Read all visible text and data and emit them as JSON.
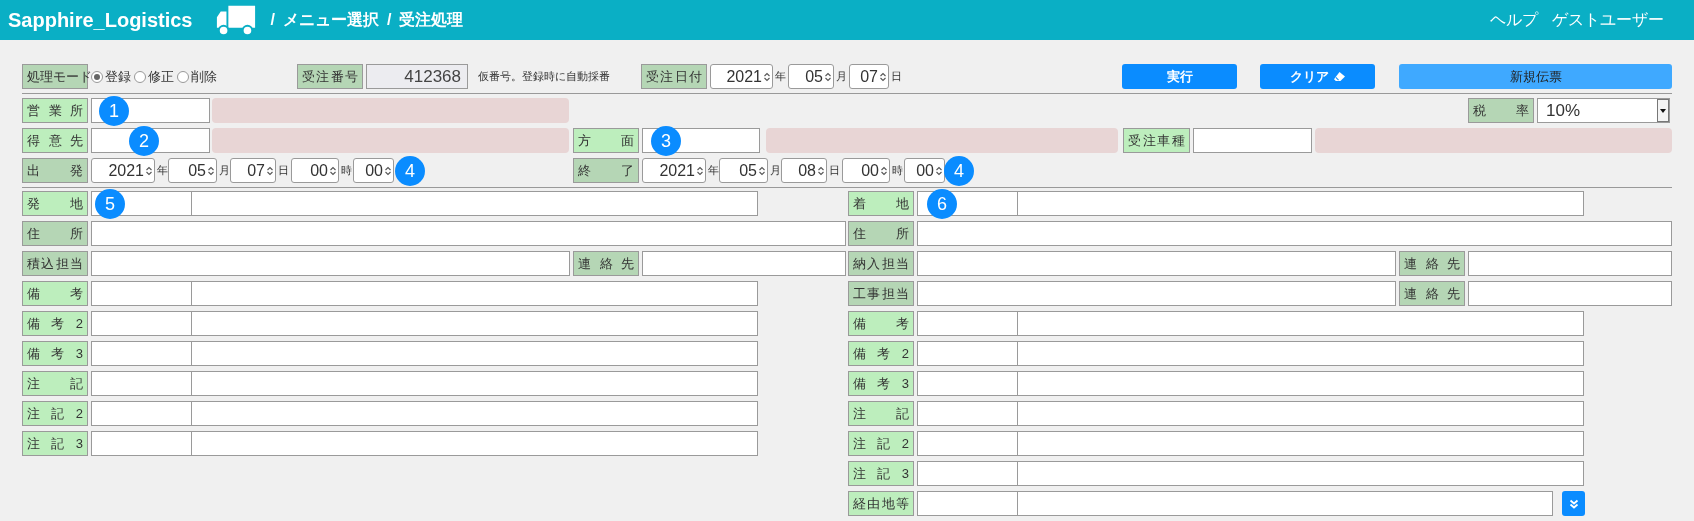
{
  "header": {
    "app_title": "Sapphire_Logistics",
    "breadcrumb": [
      {
        "separator": "/",
        "label": "メニュー選択"
      },
      {
        "separator": "/",
        "label": "受注処理"
      }
    ],
    "links": [
      "ヘルプ",
      "ゲストユーザー"
    ]
  },
  "mode": {
    "label": "処理モード",
    "color": "#b5d6b5",
    "options": [
      {
        "label": "登録",
        "selected": true
      },
      {
        "label": "修正",
        "selected": false
      },
      {
        "label": "削除",
        "selected": false
      }
    ]
  },
  "order_number": {
    "label": "受注番号",
    "color": "#b5d6b5",
    "value": "412368",
    "note": "仮番号。登録時に自動採番"
  },
  "order_date": {
    "label": "受注日付",
    "color": "#b5d6b5",
    "parts": [
      {
        "value": "2021",
        "unit": "年"
      },
      {
        "value": "05",
        "unit": "月"
      },
      {
        "value": "07",
        "unit": "日"
      }
    ]
  },
  "buttons": [
    {
      "label": "実行",
      "kind": "primary"
    },
    {
      "label": "クリア",
      "kind": "clear"
    },
    {
      "label": "新規伝票",
      "kind": "light"
    }
  ],
  "office": {
    "label": "営業所",
    "color": "#bdeebd",
    "badge": "1"
  },
  "tax_rate": {
    "label": "税率",
    "color": "#b5d6b5",
    "value": "10%"
  },
  "customer": {
    "label": "得意先",
    "color": "#bdeebd",
    "badge": "2"
  },
  "direction": {
    "label": "方面",
    "color": "#bdeebd",
    "badge": "3"
  },
  "vehicle_type": {
    "label": "受注車種",
    "color": "#bdeebd"
  },
  "start": {
    "label": "出発",
    "color": "#b5d6b5",
    "badge": "4",
    "parts": [
      {
        "value": "2021",
        "unit": "年"
      },
      {
        "value": "05",
        "unit": "月"
      },
      {
        "value": "07",
        "unit": "日"
      },
      {
        "value": "00",
        "unit": "時"
      },
      {
        "value": "00"
      }
    ]
  },
  "end": {
    "label": "終了",
    "color": "#b5d6b5",
    "badge": "4",
    "parts": [
      {
        "value": "2021",
        "unit": "年"
      },
      {
        "value": "05",
        "unit": "月"
      },
      {
        "value": "08",
        "unit": "日"
      },
      {
        "value": "00",
        "unit": "時"
      },
      {
        "value": "00"
      }
    ]
  },
  "origin": {
    "rows": [
      {
        "kind": "code_name",
        "label": "発地",
        "color": "#bdeebd",
        "badge": "5"
      },
      {
        "kind": "wide",
        "label": "住所",
        "color": "#b5d6b5"
      },
      {
        "kind": "contact",
        "label": "積込担当",
        "color": "#b5d6b5",
        "contact_label": "連絡先"
      },
      {
        "kind": "code_name",
        "label": "備考",
        "color": "#bdeebd"
      },
      {
        "kind": "code_name",
        "label": "備考2",
        "color": "#bdeebd"
      },
      {
        "kind": "code_name",
        "label": "備考3",
        "color": "#bdeebd"
      },
      {
        "kind": "code_name",
        "label": "注記",
        "color": "#bdeebd"
      },
      {
        "kind": "code_name",
        "label": "注記2",
        "color": "#bdeebd"
      },
      {
        "kind": "code_name",
        "label": "注記3",
        "color": "#bdeebd"
      }
    ]
  },
  "destination": {
    "rows": [
      {
        "kind": "code_name",
        "label": "着地",
        "color": "#bdeebd",
        "badge": "6"
      },
      {
        "kind": "wide",
        "label": "住所",
        "color": "#b5d6b5"
      },
      {
        "kind": "contact",
        "label": "納入担当",
        "color": "#b5d6b5",
        "contact_label": "連絡先"
      },
      {
        "kind": "contact",
        "label": "工事担当",
        "color": "#b5d6b5",
        "contact_label": "連絡先"
      },
      {
        "kind": "code_name",
        "label": "備考",
        "color": "#bdeebd"
      },
      {
        "kind": "code_name",
        "label": "備考2",
        "color": "#bdeebd"
      },
      {
        "kind": "code_name",
        "label": "備考3",
        "color": "#bdeebd"
      },
      {
        "kind": "code_name",
        "label": "注記",
        "color": "#bdeebd"
      },
      {
        "kind": "code_name",
        "label": "注記2",
        "color": "#bdeebd"
      },
      {
        "kind": "code_name",
        "label": "注記3",
        "color": "#bdeebd"
      },
      {
        "kind": "code_name_more",
        "label": "経由地等",
        "color": "#bdeebd"
      }
    ]
  }
}
